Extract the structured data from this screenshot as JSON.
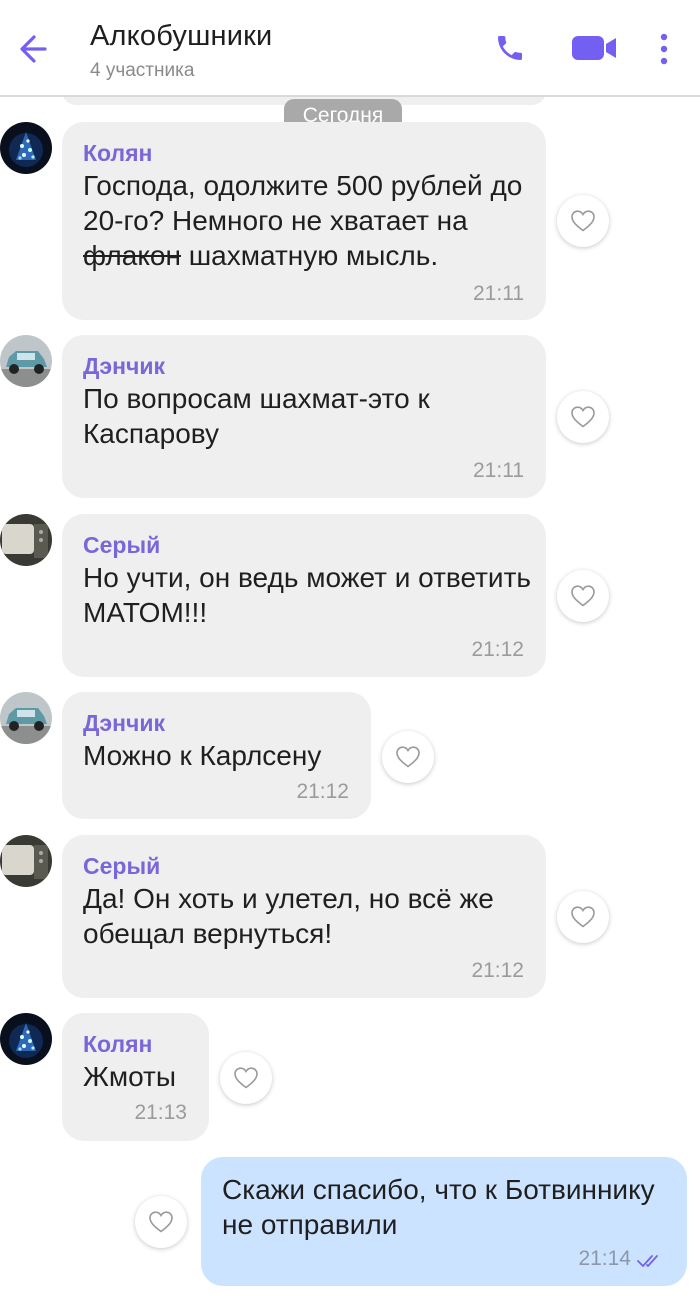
{
  "header": {
    "title": "Алкобушники",
    "subtitle": "4 участника"
  },
  "date_separator": "Сегодня",
  "messages": [
    {
      "sender": "Колян",
      "text_pre": "Господа, одолжите 500 рублей до 20-го? Немного не хватает на ",
      "text_strike": "флакон",
      "text_post": " шахматную мысль.",
      "time": "21:11"
    },
    {
      "sender": "Дэнчик",
      "text": "По вопросам шахмат-это к Каспарову",
      "time": "21:11"
    },
    {
      "sender": "Серый",
      "text": "Но учти, он ведь может и ответить МАТОМ!!!",
      "time": "21:12"
    },
    {
      "sender": "Дэнчик",
      "text": "Можно к Карлсену",
      "time": "21:12"
    },
    {
      "sender": "Серый",
      "text": "Да! Он хоть и улетел, но всё же обещал вернуться!",
      "time": "21:12"
    },
    {
      "sender": "Колян",
      "text": "Жмоты",
      "time": "21:13"
    },
    {
      "outgoing": true,
      "text": "Скажи спасибо, что к Ботвиннику не отправили",
      "time": "21:14"
    }
  ],
  "colors": {
    "accent": "#7360F2",
    "sender": "#7b66d9",
    "incoming_bubble": "#efefef",
    "outgoing_bubble": "#cce3ff"
  },
  "icons": [
    "back-arrow-icon",
    "phone-icon",
    "video-icon",
    "more-vert-icon",
    "heart-icon",
    "double-check-icon"
  ]
}
